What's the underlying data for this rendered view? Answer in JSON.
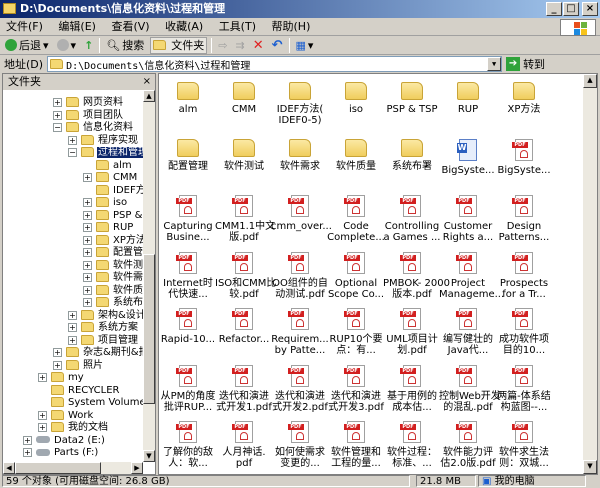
{
  "window": {
    "title": "D:\\Documents\\信息化资料\\过程和管理",
    "minimize": "_",
    "maximize": "□",
    "close": "×"
  },
  "menu": [
    "文件(F)",
    "编辑(E)",
    "查看(V)",
    "收藏(A)",
    "工具(T)",
    "帮助(H)"
  ],
  "toolbar": {
    "back": "后退",
    "search": "搜索",
    "folders": "文件夹"
  },
  "address": {
    "label": "地址(D)",
    "value": "D:\\Documents\\信息化资料\\过程和管理",
    "go": "转到"
  },
  "tree_header": {
    "title": "文件夹",
    "close": "×"
  },
  "tree": [
    {
      "label": "网页资料",
      "depth": 3,
      "exp": "+"
    },
    {
      "label": "项目团队",
      "depth": 3,
      "exp": "+"
    },
    {
      "label": "信息化资料",
      "depth": 3,
      "exp": "-"
    },
    {
      "label": "程序实现",
      "depth": 4,
      "exp": "+"
    },
    {
      "label": "过程和管理",
      "depth": 4,
      "exp": "-",
      "selected": true
    },
    {
      "label": "alm",
      "depth": 5,
      "exp": ""
    },
    {
      "label": "CMM",
      "depth": 5,
      "exp": "+"
    },
    {
      "label": "IDEF方法",
      "depth": 5,
      "exp": ""
    },
    {
      "label": "iso",
      "depth": 5,
      "exp": "+"
    },
    {
      "label": "PSP & TS",
      "depth": 5,
      "exp": "+"
    },
    {
      "label": "RUP",
      "depth": 5,
      "exp": "+"
    },
    {
      "label": "XP方法",
      "depth": 5,
      "exp": "+"
    },
    {
      "label": "配置管理",
      "depth": 5,
      "exp": "+"
    },
    {
      "label": "软件测试",
      "depth": 5,
      "exp": "+"
    },
    {
      "label": "软件需求",
      "depth": 5,
      "exp": "+"
    },
    {
      "label": "软件质量",
      "depth": 5,
      "exp": "+"
    },
    {
      "label": "系统布署",
      "depth": 5,
      "exp": "+"
    },
    {
      "label": "架构&设计",
      "depth": 4,
      "exp": "+"
    },
    {
      "label": "系统方案",
      "depth": 4,
      "exp": "+"
    },
    {
      "label": "项目管理",
      "depth": 4,
      "exp": "+"
    },
    {
      "label": "杂志&期刊&报告",
      "depth": 3,
      "exp": "+"
    },
    {
      "label": "照片",
      "depth": 3,
      "exp": "+"
    },
    {
      "label": "my",
      "depth": 2,
      "exp": "+"
    },
    {
      "label": "RECYCLER",
      "depth": 2,
      "exp": ""
    },
    {
      "label": "System Volume Info",
      "depth": 2,
      "exp": ""
    },
    {
      "label": "Work",
      "depth": 2,
      "exp": "+"
    },
    {
      "label": "我的文档",
      "depth": 2,
      "exp": "+"
    },
    {
      "label": "Data2 (E:)",
      "depth": 1,
      "exp": "+",
      "icon": "drive"
    },
    {
      "label": "Parts (F:)",
      "depth": 1,
      "exp": "+",
      "icon": "drive"
    }
  ],
  "files": [
    {
      "type": "folder",
      "lines": [
        "alm"
      ]
    },
    {
      "type": "folder",
      "lines": [
        "CMM"
      ]
    },
    {
      "type": "folder",
      "lines": [
        "IDEF方法(",
        "IDEF0-5)"
      ]
    },
    {
      "type": "folder",
      "lines": [
        "iso"
      ]
    },
    {
      "type": "folder",
      "lines": [
        "PSP & TSP"
      ]
    },
    {
      "type": "folder",
      "lines": [
        "RUP"
      ]
    },
    {
      "type": "folder",
      "lines": [
        "XP方法"
      ]
    },
    {
      "type": "folder",
      "lines": [
        "配置管理"
      ]
    },
    {
      "type": "folder",
      "lines": [
        "软件测试"
      ]
    },
    {
      "type": "folder",
      "lines": [
        "软件需求"
      ]
    },
    {
      "type": "folder",
      "lines": [
        "软件质量"
      ]
    },
    {
      "type": "folder",
      "lines": [
        "系统布署"
      ]
    },
    {
      "type": "word",
      "lines": [
        "BigSyste..."
      ]
    },
    {
      "type": "pdf",
      "lines": [
        "BigSyste..."
      ]
    },
    {
      "type": "pdf",
      "lines": [
        "Capturing",
        "Busine..."
      ]
    },
    {
      "type": "pdf",
      "lines": [
        "CMM1.1中文",
        "版.pdf"
      ]
    },
    {
      "type": "pdf",
      "lines": [
        "cmm_over..."
      ]
    },
    {
      "type": "pdf",
      "lines": [
        "Code",
        "Complete..."
      ]
    },
    {
      "type": "pdf",
      "lines": [
        "Controlling",
        "a Games ..."
      ]
    },
    {
      "type": "pdf",
      "lines": [
        "Customer",
        "Rights a..."
      ]
    },
    {
      "type": "pdf",
      "lines": [
        "Design",
        "Patterns..."
      ]
    },
    {
      "type": "pdf",
      "lines": [
        "Internet时",
        "代快速..."
      ]
    },
    {
      "type": "pdf",
      "lines": [
        "ISO和CMM比",
        "较.pdf"
      ]
    },
    {
      "type": "pdf",
      "lines": [
        "OO组件的自",
        "动测试.pdf"
      ]
    },
    {
      "type": "pdf",
      "lines": [
        "Optional",
        "Scope Co..."
      ]
    },
    {
      "type": "pdf",
      "lines": [
        "PMBOK- 2000",
        "版本.pdf"
      ]
    },
    {
      "type": "pdf",
      "lines": [
        "Project",
        "Manageme..."
      ]
    },
    {
      "type": "pdf",
      "lines": [
        "Prospects",
        "for a Tr..."
      ]
    },
    {
      "type": "pdf",
      "lines": [
        "Rapid-10..."
      ]
    },
    {
      "type": "pdf",
      "lines": [
        "Refactor..."
      ]
    },
    {
      "type": "pdf",
      "lines": [
        "Requirem...",
        "by Patte..."
      ]
    },
    {
      "type": "pdf",
      "lines": [
        "RUP10个要",
        "点：有..."
      ]
    },
    {
      "type": "pdf",
      "lines": [
        "UML项目计",
        "划.pdf"
      ]
    },
    {
      "type": "pdf",
      "lines": [
        "编写健壮的",
        "Java代..."
      ]
    },
    {
      "type": "pdf",
      "lines": [
        "成功软件项",
        "目的10..."
      ]
    },
    {
      "type": "pdf",
      "lines": [
        "从PM的角度",
        "批评RUP..."
      ]
    },
    {
      "type": "pdf",
      "lines": [
        "迭代和演进",
        "式开发1.pdf"
      ]
    },
    {
      "type": "pdf",
      "lines": [
        "迭代和演进",
        "式开发2.pdf"
      ]
    },
    {
      "type": "pdf",
      "lines": [
        "迭代和演进",
        "式开发3.pdf"
      ]
    },
    {
      "type": "pdf",
      "lines": [
        "基于用例的",
        "成本估..."
      ]
    },
    {
      "type": "pdf",
      "lines": [
        "控制Web开发",
        "的混乱.pdf"
      ]
    },
    {
      "type": "pdf",
      "lines": [
        "两篇-体系结",
        "构蓝图--..."
      ]
    },
    {
      "type": "pdf",
      "lines": [
        "了解你的敌",
        "人：软..."
      ]
    },
    {
      "type": "pdf",
      "lines": [
        "人月神话.",
        "pdf"
      ]
    },
    {
      "type": "pdf",
      "lines": [
        "如何使需求",
        "变更的..."
      ]
    },
    {
      "type": "pdf",
      "lines": [
        "软件管理和",
        "工程的量..."
      ]
    },
    {
      "type": "pdf",
      "lines": [
        "软件过程：",
        "标准、..."
      ]
    },
    {
      "type": "pdf",
      "lines": [
        "软件能力评",
        "估2.0版.pdf"
      ]
    },
    {
      "type": "pdf",
      "lines": [
        "软件求生法",
        "则：双城..."
      ]
    }
  ],
  "icons": {
    "pdf_badge": "PDF",
    "word_badge": "W"
  },
  "status": {
    "objects": "59 个对象 (可用磁盘空间: 26.8 GB)",
    "size": "21.8 MB",
    "location": "我的电脑"
  },
  "colors": {
    "titlebar": "#0a246a",
    "selection": "#0a246a",
    "folder": "#f0cd5d",
    "pdf": "#d21f1f"
  }
}
